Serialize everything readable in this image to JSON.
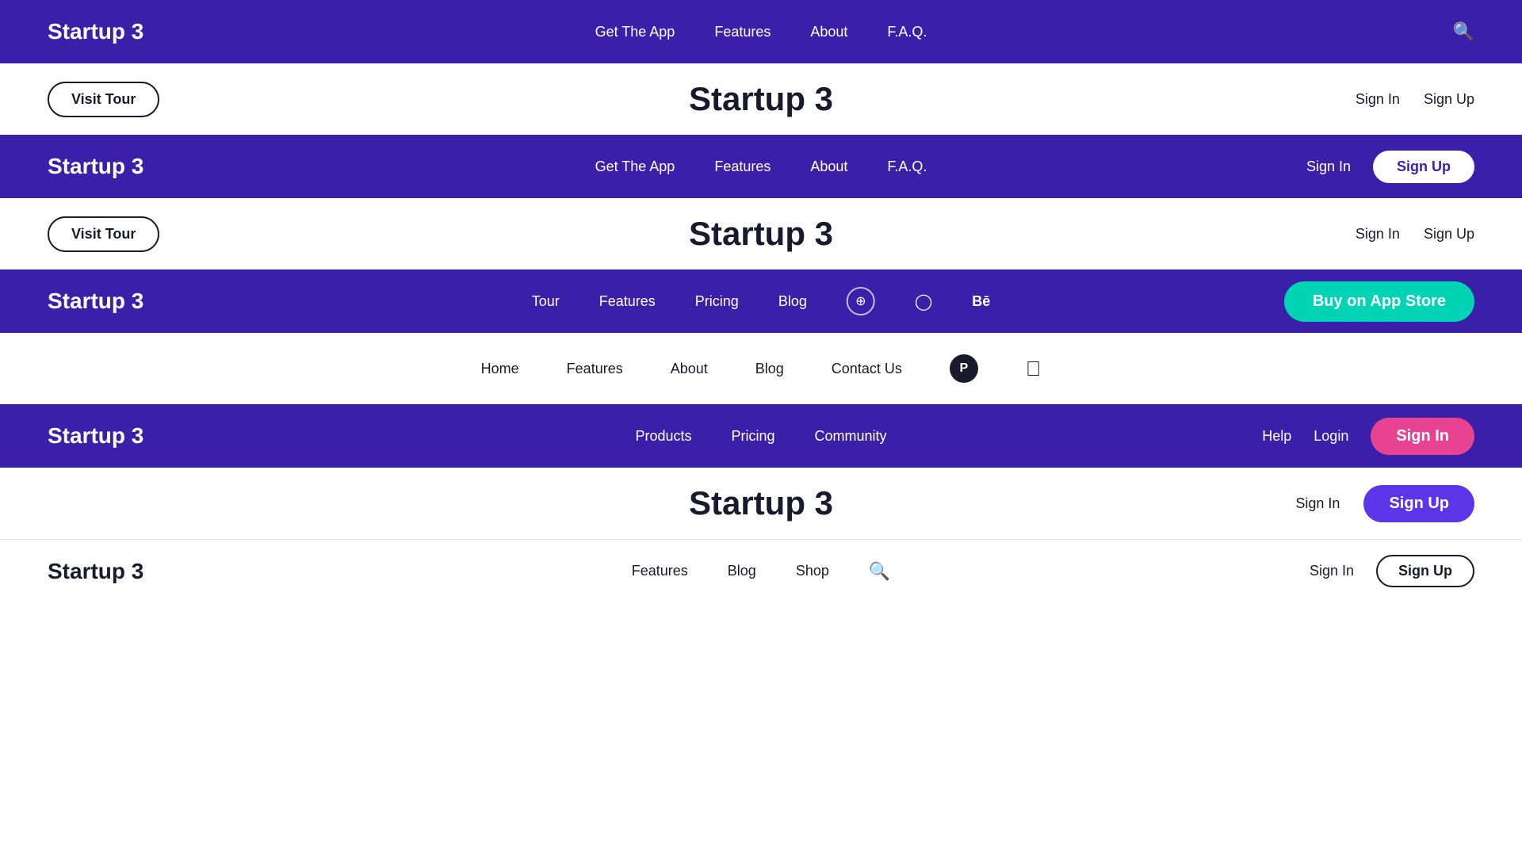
{
  "navbars": [
    {
      "id": "navbar-1",
      "theme": "dark",
      "brand": "Startup 3",
      "brand_theme": "white",
      "center_links": [
        {
          "label": "Get The App"
        },
        {
          "label": "Features"
        },
        {
          "label": "About"
        },
        {
          "label": "F.A.Q."
        }
      ],
      "right": {
        "signin": null,
        "signup": null,
        "cta": null,
        "search_icon": true
      }
    },
    {
      "id": "content-1",
      "type": "content",
      "theme": "light",
      "left_btn": "Visit Tour",
      "center_title": "Startup 3",
      "right": {
        "signin": "Sign In",
        "signup": "Sign Up",
        "signup_style": "text"
      }
    },
    {
      "id": "navbar-2",
      "theme": "dark",
      "brand": "Startup 3",
      "brand_theme": "white",
      "center_links": [
        {
          "label": "Get The App"
        },
        {
          "label": "Features"
        },
        {
          "label": "About"
        },
        {
          "label": "F.A.Q."
        }
      ],
      "right": {
        "signin": "Sign In",
        "signup": "Sign Up",
        "signup_style": "outline_white"
      }
    },
    {
      "id": "content-2",
      "type": "content",
      "theme": "light",
      "left_btn": "Visit Tour",
      "center_title": "Startup 3",
      "right": {
        "signin": "Sign In",
        "signup": "Sign Up",
        "signup_style": "text"
      }
    },
    {
      "id": "navbar-3",
      "theme": "dark",
      "brand": "Startup 3",
      "brand_theme": "white",
      "center_links": [
        {
          "label": "Tour"
        },
        {
          "label": "Features"
        },
        {
          "label": "Pricing"
        },
        {
          "label": "Blog"
        }
      ],
      "socials": [
        "dribbble",
        "instagram",
        "behance"
      ],
      "right": {
        "cta": "Buy on App Store",
        "cta_style": "teal"
      }
    },
    {
      "id": "content-3",
      "type": "content",
      "theme": "light",
      "left_btn": null,
      "center_title": null,
      "links": [
        {
          "label": "Home"
        },
        {
          "label": "Features"
        },
        {
          "label": "About"
        },
        {
          "label": "Blog"
        },
        {
          "label": "Contact Us"
        }
      ],
      "right_icons": [
        "producthunt",
        "apple"
      ]
    },
    {
      "id": "navbar-4",
      "theme": "dark",
      "brand": "Startup 3",
      "brand_theme": "white",
      "center_links": [
        {
          "label": "Products"
        },
        {
          "label": "Pricing"
        },
        {
          "label": "Community"
        }
      ],
      "right": {
        "help": "Help",
        "login": "Login",
        "signin": "Sign In",
        "signin_style": "pink"
      }
    },
    {
      "id": "content-4",
      "type": "content",
      "theme": "light",
      "center_title": "Startup 3",
      "right": {
        "signin": "Sign In",
        "signup": "Sign Up",
        "signup_style": "purple"
      }
    },
    {
      "id": "navbar-5",
      "theme": "light",
      "brand": "Startup 3",
      "brand_theme": "dark",
      "center_links": [
        {
          "label": "Features"
        },
        {
          "label": "Blog"
        },
        {
          "label": "Shop"
        }
      ],
      "right": {
        "search": true,
        "signin": "Sign In",
        "signup": "Sign Up",
        "signup_style": "outline_dark"
      }
    }
  ],
  "labels": {
    "visit_tour": "Visit Tour",
    "sign_in": "Sign In",
    "sign_up": "Sign Up",
    "buy_app_store": "Buy on App Store",
    "help": "Help",
    "login": "Login",
    "startup3": "Startup 3"
  },
  "colors": {
    "dark_bg": "#3a1fa8",
    "light_bg": "#ffffff",
    "teal": "#00d4b4",
    "pink": "#e84393",
    "purple": "#5c35e8",
    "text_dark": "#1a1a2e",
    "text_white": "#ffffff"
  }
}
